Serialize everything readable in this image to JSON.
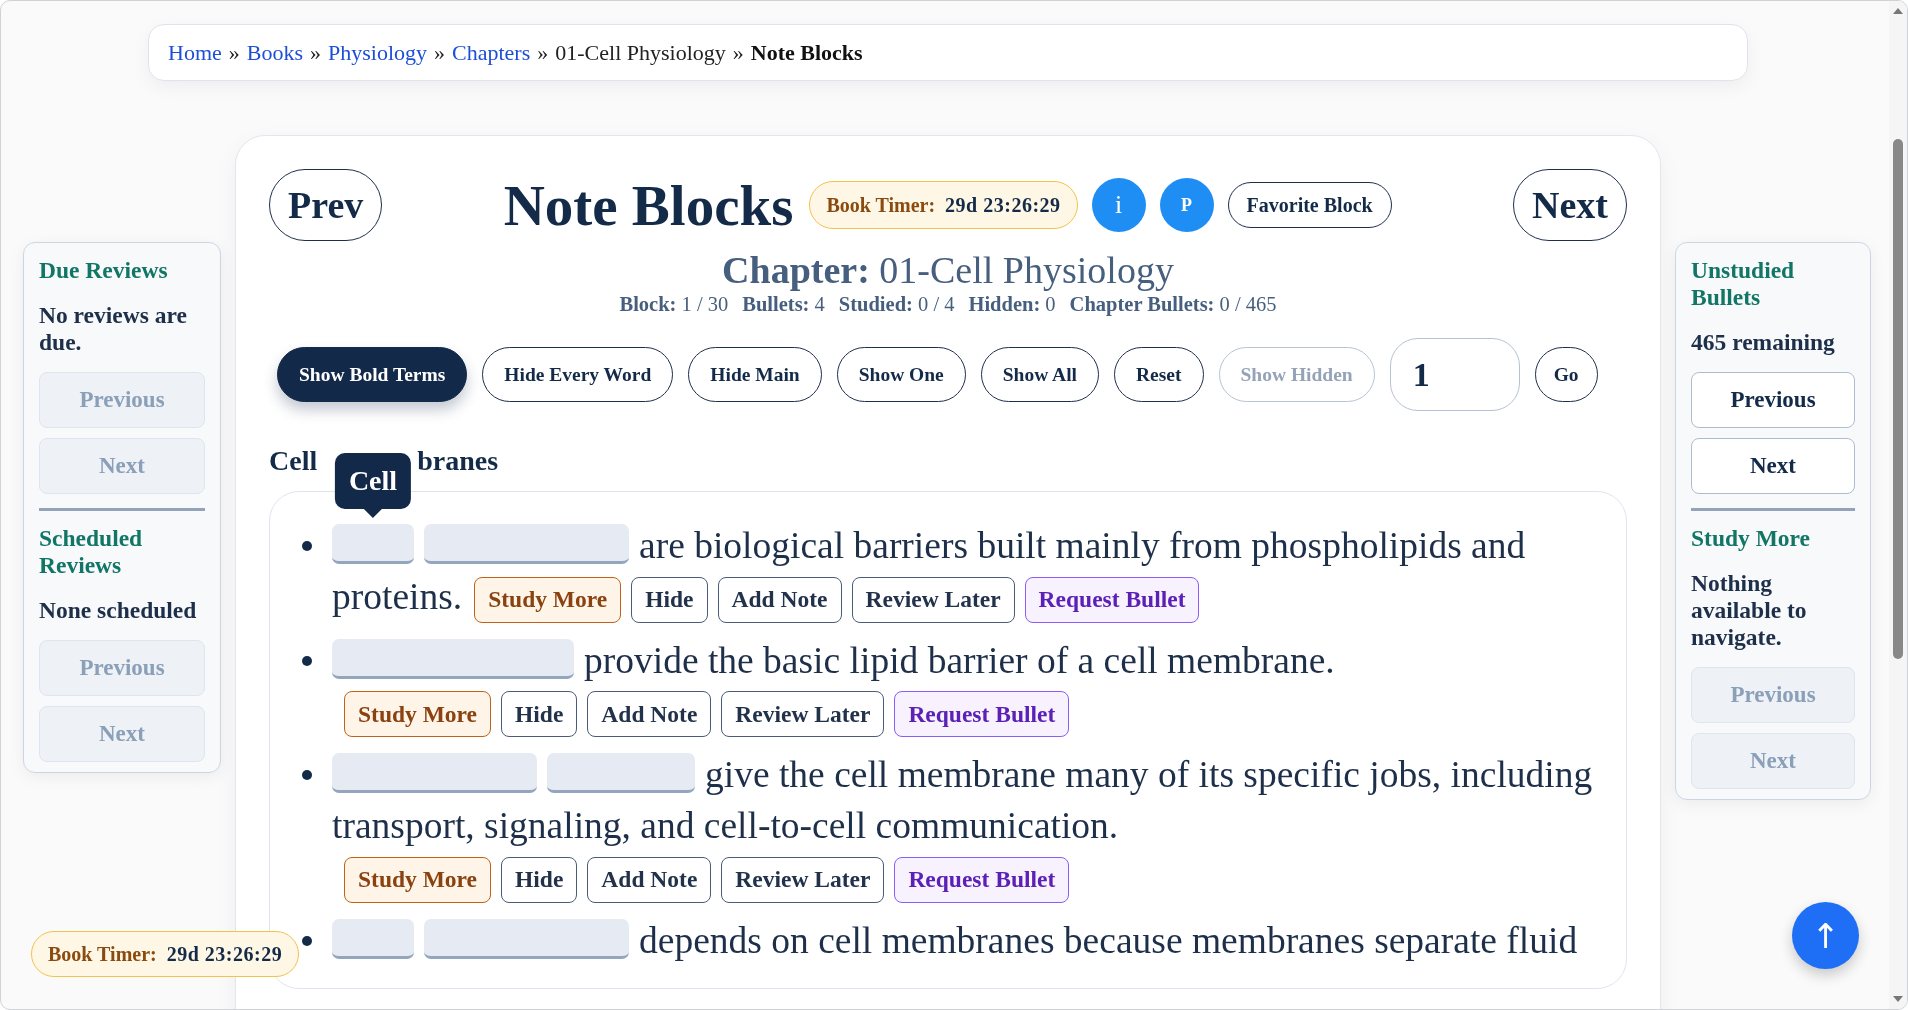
{
  "breadcrumb": [
    {
      "label": "Home",
      "kind": "link"
    },
    {
      "sep": "»",
      "label": "Books",
      "kind": "link"
    },
    {
      "sep": "»",
      "label": "Physiology",
      "kind": "link"
    },
    {
      "sep": "»",
      "label": "Chapters",
      "kind": "link"
    },
    {
      "sep": "»",
      "label": "01-Cell Physiology",
      "kind": "plain"
    },
    {
      "sep": "»",
      "label": "Note Blocks",
      "kind": "current"
    }
  ],
  "left_panel": [
    {
      "title": "Due Reviews",
      "message": "No reviews are due.",
      "buttons": [
        {
          "label": "Previous",
          "disabled": true
        },
        {
          "label": "Next",
          "disabled": true
        }
      ]
    },
    {
      "title": "Scheduled Reviews",
      "message": "None scheduled",
      "buttons": [
        {
          "label": "Previous",
          "disabled": true
        },
        {
          "label": "Next",
          "disabled": true
        }
      ]
    }
  ],
  "right_panel": [
    {
      "title": "Unstudied Bullets",
      "message": "465 remaining",
      "buttons": [
        {
          "label": "Previous",
          "disabled": false
        },
        {
          "label": "Next",
          "disabled": false
        }
      ]
    },
    {
      "title": "Study More",
      "message": "Nothing available to navigate.",
      "buttons": [
        {
          "label": "Previous",
          "disabled": true
        },
        {
          "label": "Next",
          "disabled": true
        }
      ]
    }
  ],
  "header": {
    "prev": "Prev",
    "title": "Note Blocks",
    "timer_label": "Book Timer:",
    "timer_value": "29d 23:26:29",
    "info": "i",
    "p": "P",
    "favorite": "Favorite Block",
    "next": "Next"
  },
  "chapter": "**Chapter:** 01-Cell Physiology",
  "stats": [
    "**Block:** 1 / 30",
    "**Bullets:** 4",
    "**Studied:** 0 / 4",
    "**Hidden:** 0",
    "**Chapter Bullets:** 0 / 465"
  ],
  "toolbar": [
    {
      "label": "Show Bold Terms",
      "selected": true,
      "disabled": false
    },
    {
      "label": "Hide Every Word",
      "selected": false,
      "disabled": false
    },
    {
      "label": "Hide Main",
      "selected": false,
      "disabled": false
    },
    {
      "label": "Show One",
      "selected": false,
      "disabled": false
    },
    {
      "label": "Show All",
      "selected": false,
      "disabled": false
    },
    {
      "label": "Reset",
      "selected": false,
      "disabled": false
    },
    {
      "label": "Show Hidden",
      "selected": false,
      "disabled": true
    }
  ],
  "jump": {
    "value": "1",
    "button": "Go"
  },
  "section": {
    "visible_start": "Cell",
    "visible_end": "branes"
  },
  "tooltip": "Cell",
  "bullets": [
    {
      "parts": [
        {
          "kind": "blank-s"
        },
        {
          "kind": "blank-l"
        },
        {
          "kind": "text",
          "text": "are biological barriers built mainly from phospholipids and"
        },
        {
          "kind": "break"
        },
        {
          "kind": "text",
          "text": "proteins."
        }
      ],
      "actions": [
        {
          "label": "Study More",
          "kind": "study"
        },
        {
          "label": "Hide",
          "kind": "plain"
        },
        {
          "label": "Add Note",
          "kind": "plain"
        },
        {
          "label": "Review Later",
          "kind": "plain"
        },
        {
          "label": "Request Bullet",
          "kind": "request"
        }
      ]
    },
    {
      "parts": [
        {
          "kind": "blank-xl"
        },
        {
          "kind": "text",
          "text": "provide the basic lipid barrier of a cell membrane."
        },
        {
          "kind": "break"
        }
      ],
      "actions": [
        {
          "label": "Study More",
          "kind": "study"
        },
        {
          "label": "Hide",
          "kind": "plain"
        },
        {
          "label": "Add Note",
          "kind": "plain"
        },
        {
          "label": "Review Later",
          "kind": "plain"
        },
        {
          "label": "Request Bullet",
          "kind": "request"
        }
      ]
    },
    {
      "parts": [
        {
          "kind": "blank-l"
        },
        {
          "kind": "blank-m"
        },
        {
          "kind": "text",
          "text": "give the cell membrane many of its specific jobs, including"
        },
        {
          "kind": "break"
        },
        {
          "kind": "text",
          "text": "transport, signaling, and cell-to-cell communication."
        },
        {
          "kind": "break"
        }
      ],
      "actions": [
        {
          "label": "Study More",
          "kind": "study"
        },
        {
          "label": "Hide",
          "kind": "plain"
        },
        {
          "label": "Add Note",
          "kind": "plain"
        },
        {
          "label": "Review Later",
          "kind": "plain"
        },
        {
          "label": "Request Bullet",
          "kind": "request"
        }
      ]
    },
    {
      "parts": [
        {
          "kind": "blank-s"
        },
        {
          "kind": "blank-l"
        },
        {
          "kind": "text",
          "text": "depends on cell membranes because membranes separate fluid"
        }
      ]
    }
  ],
  "floating_timer": {
    "label": "Book Timer:",
    "value": "29d 23:26:29"
  },
  "scroll_top": "↑"
}
